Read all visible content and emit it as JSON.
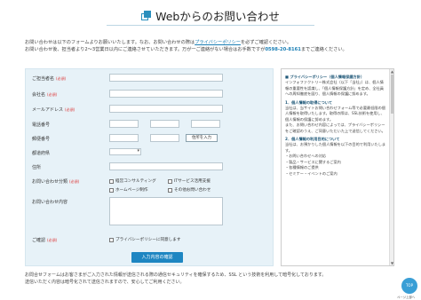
{
  "page": {
    "title": "Webからのお問い合わせ",
    "intro_line1_a": "お問い合わせは以下のフォームよりお願いいたします。なお、お問い合わせの際は",
    "intro_link": "プライバシーポリシー",
    "intro_line1_b": "を必ずご確認ください。",
    "intro_line2_a": "お問い合わせ後、担当者より2〜3営業日以内にご連絡させていただきます。万が一ご連絡がない場合はお手数ですが",
    "intro_tel": "0598-20-8161",
    "intro_line2_b": "までご連絡ください。"
  },
  "form": {
    "required_mark": "(必須)",
    "name_label": "ご担当者名",
    "company_label": "会社名",
    "email_label": "メールアドレス",
    "phone_label": "電話番号",
    "zip_label": "郵便番号",
    "zip_button": "住所を入力",
    "pref_label": "都道府県",
    "address_label": "住所",
    "category_label": "お問い合わせ分類",
    "category_options": [
      "経営コンサルティング",
      "ITサービス活用支援",
      "ホームページ制作",
      "その他お問い合わせ"
    ],
    "content_label": "お問い合わせ内容",
    "confirm_label": "ご確認",
    "confirm_checkbox": "プライバシーポリシーに同意します",
    "submit": "入力内容の確認"
  },
  "policy": {
    "heading1": "■ プライバシーポリシー（個人情報保護方針）",
    "p1": "インフォファクトリー株式会社（以下「当社」）は、個人情報の重要性を認識し、「個人情報保護方針」を定め、全社員への周知徹底を図り、個人情報の保護に努めます。",
    "heading2": "1．個人情報の取得について",
    "p2": "当社は、当サイトお問い合わせフォーム等で必要最低限の個人情報を取得いたします。取得の際は、SSL技術を使用し、個人情報の保護に努めます。",
    "p3": "また、お問い合わせ内容によっては、プライバシーポリシーをご確認のうえ、ご同意いただいた上で送信してください。",
    "heading3": "2．個人情報の利用目的について",
    "p4": "当社は、お預かりした個人情報を以下の目的で利用いたします。",
    "list": [
      "・お問い合わせへの対応",
      "・製品・サービスに関するご案内",
      "・各種情報のご提供",
      "・セミナー・イベントのご案内"
    ]
  },
  "footer": {
    "line1": "お問合せフォームはお客さまがご入力された情報が送信される際の通信セキュリティを確保するため、SSL という技術を利用して暗号化しております。",
    "line2": "送信いただく内容は暗号化されて送信されますので、安心してご利用ください。"
  },
  "badge": {
    "text": "TOP",
    "label": "ページ上部へ"
  },
  "colors": {
    "accent": "#1e86c2",
    "panel": "#e7f2f8",
    "required": "#dd3333"
  }
}
